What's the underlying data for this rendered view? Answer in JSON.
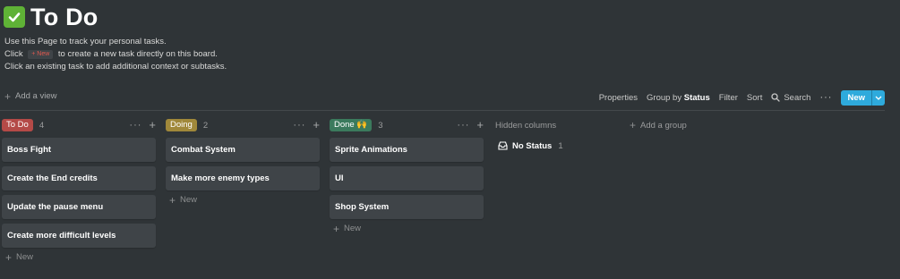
{
  "page": {
    "title": "To Do",
    "description": [
      "Use this Page to track your personal tasks.",
      {
        "before": "Click",
        "chip": "+ New",
        "after": "to create a new task directly on this board."
      },
      "Click an existing task to add additional context or subtasks."
    ]
  },
  "views": {
    "add_view_label": "Add a view"
  },
  "toolbar": {
    "properties": "Properties",
    "group_by_prefix": "Group by",
    "group_by_value": "Status",
    "filter": "Filter",
    "sort": "Sort",
    "search": "Search",
    "more": "···",
    "new_button": "New"
  },
  "columns": [
    {
      "label": "To Do",
      "count": "4",
      "color": "#b44a47",
      "cards": [
        "Boss Fight",
        "Create the End credits",
        "Update the pause menu",
        "Create more difficult levels"
      ],
      "new_label": "New"
    },
    {
      "label": "Doing",
      "count": "2",
      "color": "#a0883a",
      "cards": [
        "Combat System",
        "Make more enemy types"
      ],
      "new_label": "New"
    },
    {
      "label": "Done 🙌",
      "count": "3",
      "color": "#3b7a5d",
      "cards": [
        "Sprite Animations",
        "UI",
        "Shop System"
      ],
      "new_label": "New"
    }
  ],
  "hidden_columns": {
    "title": "Hidden columns",
    "items": [
      {
        "label": "No Status",
        "count": "1"
      }
    ]
  },
  "add_group_label": "Add a group",
  "colors": {
    "background": "#2f3437",
    "card": "#3f4448",
    "accent": "#2eaadc",
    "check": "#5fb236"
  }
}
